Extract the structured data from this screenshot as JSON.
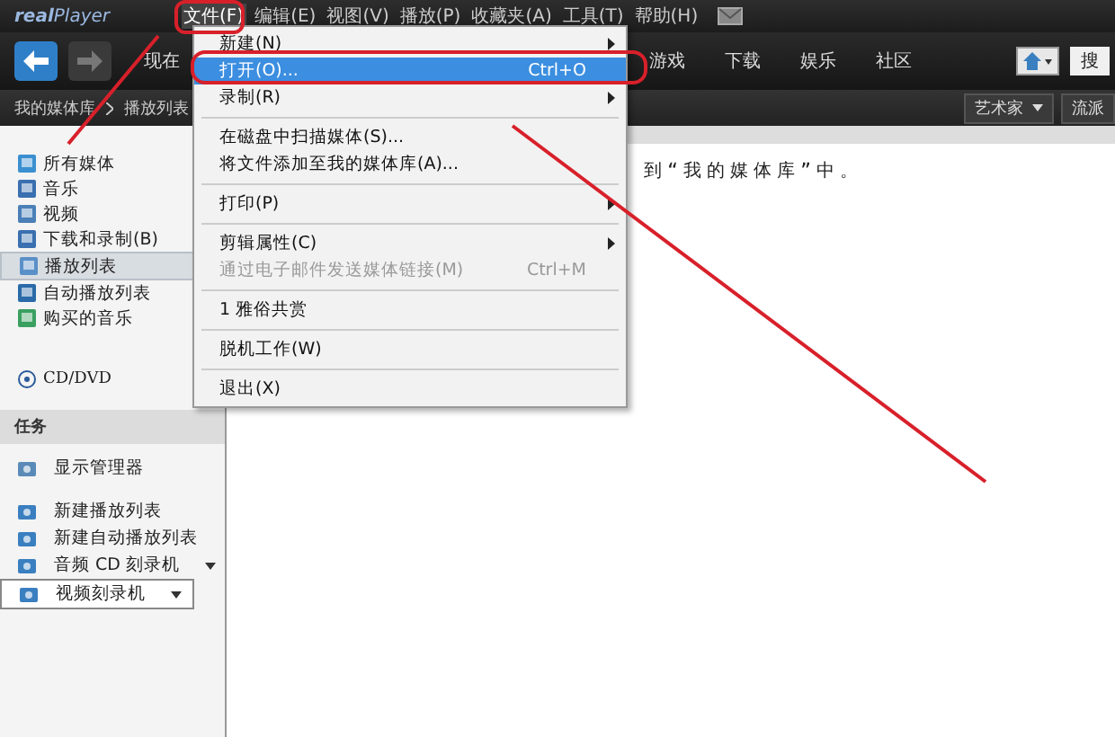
{
  "title_bar": {
    "logo": "**real**Player",
    "menus": [
      {
        "label": "文件(F)",
        "selected": true
      },
      {
        "label": "编辑(E)",
        "selected": false
      },
      {
        "label": "视图(V)",
        "selected": false
      },
      {
        "label": "播放(P)",
        "selected": false
      },
      {
        "label": "收藏夹(A)",
        "selected": false
      },
      {
        "label": "工具(T)",
        "selected": false
      },
      {
        "label": "帮助(H)",
        "selected": false
      }
    ]
  },
  "nav": {
    "now_label": "现在",
    "tabs": [
      {
        "label": "游戏",
        "selected": false
      },
      {
        "label": "下载",
        "selected": false
      },
      {
        "label": "娱乐",
        "selected": false
      },
      {
        "label": "社区",
        "selected": false
      }
    ],
    "search_label": "搜"
  },
  "breadcrumb": [
    "我的媒体库",
    "播放列表"
  ],
  "filters": [
    {
      "label": "艺术家",
      "dropdown": true
    },
    {
      "label": "流派",
      "dropdown": false
    }
  ],
  "sidebar": {
    "library": [
      {
        "label": "所有媒体",
        "selected": false
      },
      {
        "label": "音乐",
        "selected": false
      },
      {
        "label": "视频",
        "selected": false
      },
      {
        "label": "下载和录制(B)",
        "selected": false
      },
      {
        "label": "播放列表",
        "selected": true
      },
      {
        "label": "自动播放列表",
        "selected": false
      },
      {
        "label": "购买的音乐",
        "selected": false
      }
    ],
    "device": "CD/DVD",
    "tasks_header": "任务",
    "tasks": [
      {
        "label": "显示管理器",
        "dropdown": false,
        "selected": false
      },
      {
        "label": "新建播放列表",
        "dropdown": false,
        "selected": false
      },
      {
        "label": "新建自动播放列表",
        "dropdown": false,
        "selected": false
      },
      {
        "label": "音频 CD 刻录机",
        "dropdown": true,
        "selected": false
      },
      {
        "label": "视频刻录机",
        "dropdown": true,
        "selected": true
      }
    ]
  },
  "content": {
    "text": "到“我的媒体库”中。"
  },
  "file_menu": [
    {
      "kind": "item",
      "label": "新建(N)",
      "submenu": true,
      "selected": false,
      "disabled": false
    },
    {
      "kind": "item",
      "label": "打开(O)...",
      "shortcut": "Ctrl+O",
      "submenu": false,
      "selected": true,
      "disabled": false
    },
    {
      "kind": "item",
      "label": "录制(R)",
      "submenu": true,
      "selected": false,
      "disabled": false
    },
    {
      "kind": "separator"
    },
    {
      "kind": "item",
      "label": "在磁盘中扫描媒体(S)...",
      "submenu": false,
      "selected": false,
      "disabled": false
    },
    {
      "kind": "item",
      "label": "将文件添加至我的媒体库(A)...",
      "submenu": false,
      "selected": false,
      "disabled": false
    },
    {
      "kind": "separator"
    },
    {
      "kind": "item",
      "label": "打印(P)",
      "submenu": true,
      "selected": false,
      "disabled": false
    },
    {
      "kind": "separator"
    },
    {
      "kind": "item",
      "label": "剪辑属性(C)",
      "submenu": true,
      "selected": false,
      "disabled": false
    },
    {
      "kind": "item",
      "label": "通过电子邮件发送媒体链接(M)",
      "shortcut": "Ctrl+M",
      "submenu": false,
      "selected": false,
      "disabled": true
    },
    {
      "kind": "separator"
    },
    {
      "kind": "item",
      "label": "1 雅俗共赏",
      "submenu": false,
      "selected": false,
      "disabled": false
    },
    {
      "kind": "separator"
    },
    {
      "kind": "item",
      "label": "脱机工作(W)",
      "submenu": false,
      "selected": false,
      "disabled": false
    },
    {
      "kind": "separator"
    },
    {
      "kind": "item",
      "label": "退出(X)",
      "submenu": false,
      "selected": false,
      "disabled": false
    }
  ]
}
